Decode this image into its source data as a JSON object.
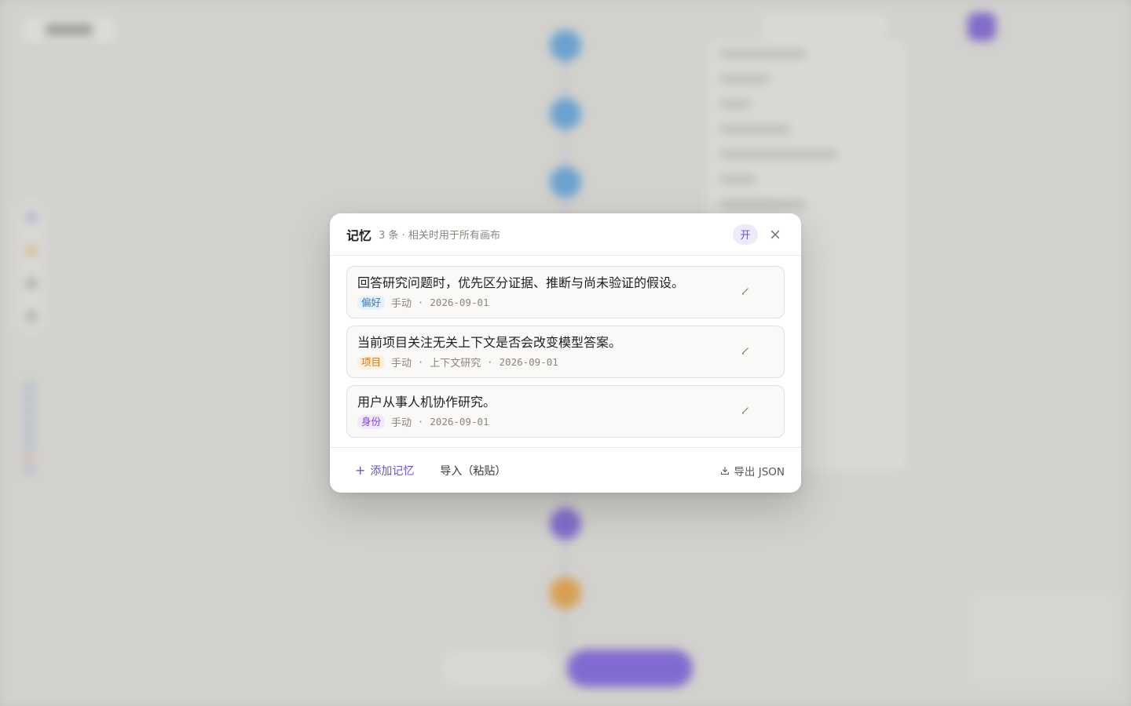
{
  "modal": {
    "title": "记忆",
    "subtitle": "3 条 · 相关时用于所有画布",
    "toggle_label": "开",
    "close_icon": "close-icon",
    "memories": [
      {
        "text": "回答研究问题时，优先区分证据、推断与尚未验证的假设。",
        "tag": "偏好",
        "tag_color": "#2f7bc4",
        "source": "手动",
        "project": "",
        "date": "2026-09-01"
      },
      {
        "text": "当前项目关注无关上下文是否会改变模型答案。",
        "tag": "项目",
        "tag_color": "#d27a1c",
        "source": "手动",
        "project": "上下文研究",
        "date": "2026-09-01"
      },
      {
        "text": "用户从事人机协作研究。",
        "tag": "身份",
        "tag_color": "#8043d6",
        "source": "手动",
        "project": "",
        "date": "2026-09-01"
      }
    ],
    "footer": {
      "add_label": "添加记忆",
      "import_label": "导入（粘贴）",
      "export_label": "导出 JSON"
    }
  },
  "colors": {
    "accent": "#6a52d4",
    "toggle_bg": "#eeeafb"
  }
}
